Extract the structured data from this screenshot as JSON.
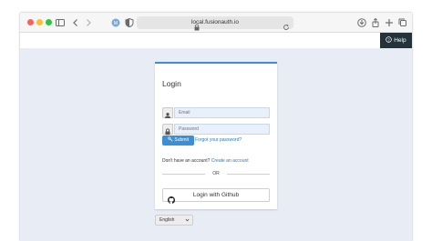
{
  "browser": {
    "url": "local.fusionauth.io",
    "colors": {
      "close": "#ff5f57",
      "minimize": "#febc2e",
      "zoom": "#28c840"
    },
    "icons": [
      "sidebar-icon",
      "back-icon",
      "forward-icon",
      "extension-icon",
      "privacy-shield-icon",
      "lock-icon",
      "reload-icon",
      "download-icon",
      "share-icon",
      "new-tab-icon",
      "tab-overview-icon"
    ]
  },
  "header": {
    "help_label": "Help",
    "help_icon": "question-circle-icon"
  },
  "login": {
    "title": "Login",
    "email_placeholder": "Email",
    "password_placeholder": "Password",
    "submit_label": "Submit",
    "forgot_label": "Forgot your password?",
    "no_account_text": "Don't have an account?",
    "create_account_label": "Create an account",
    "or_label": "OR",
    "github_label": "Login with Github",
    "accent_color": "#3a8fd6"
  },
  "footer": {
    "language": "English"
  }
}
